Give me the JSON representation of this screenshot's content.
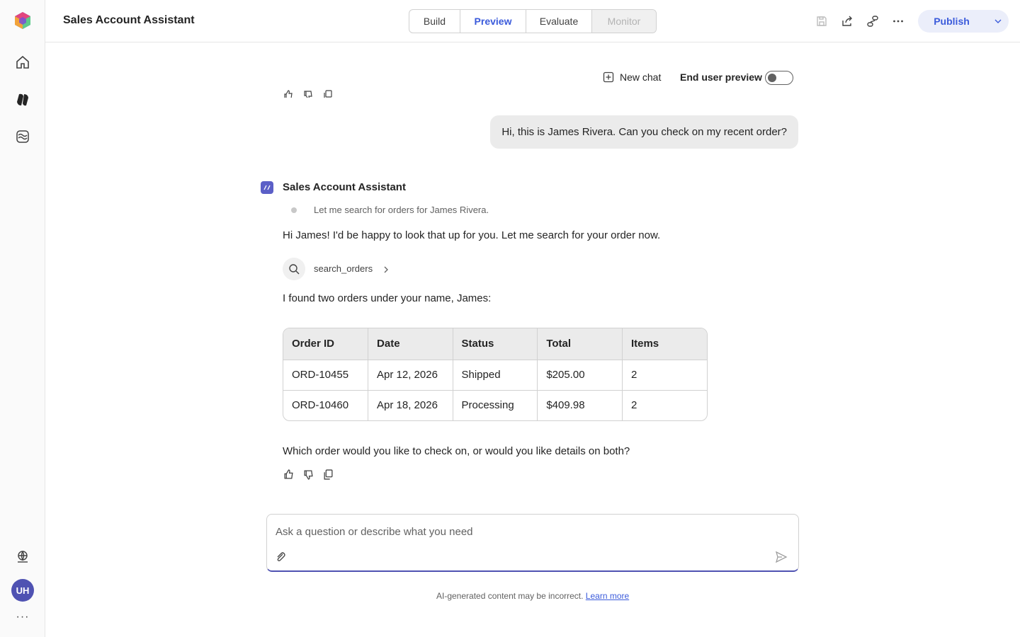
{
  "header": {
    "title": "Sales Account Assistant",
    "tabs": [
      {
        "label": "Build",
        "state": "normal"
      },
      {
        "label": "Preview",
        "state": "active"
      },
      {
        "label": "Evaluate",
        "state": "normal"
      },
      {
        "label": "Monitor",
        "state": "disabled"
      }
    ],
    "icons": [
      "save-icon",
      "share-icon",
      "link-icon",
      "more-icon"
    ],
    "publish_label": "Publish"
  },
  "rail": {
    "icons": [
      "app-logo-icon",
      "home-icon",
      "agents-icon",
      "knowledge-icon",
      "globe-icon"
    ],
    "avatar_initials": "UH",
    "more": "···"
  },
  "controls": {
    "new_chat": "New chat",
    "end_user_preview": "End user preview",
    "end_user_preview_on": false
  },
  "chat": {
    "user_message": "Hi, this is James Rivera. Can you check on my recent order?",
    "bot_name": "Sales Account Assistant",
    "thinking": "Let me search for orders for James Rivera.",
    "reply_intro": "Hi James! I'd be happy to look that up for you. Let me search for your order now.",
    "tool_call": "search_orders",
    "found_text": "I found two orders under your name, James:",
    "orders": {
      "headers": [
        "Order ID",
        "Date",
        "Status",
        "Total",
        "Items"
      ],
      "rows": [
        [
          "ORD-10455",
          "Apr 12, 2026",
          "Shipped",
          "$205.00",
          "2"
        ],
        [
          "ORD-10460",
          "Apr 18, 2026",
          "Processing",
          "$409.98",
          "2"
        ]
      ]
    },
    "question": "Which order would you like to check on, or would you like details on both?"
  },
  "composer": {
    "placeholder": "Ask a question or describe what you need"
  },
  "footer": {
    "disclaimer": "AI-generated content may be incorrect.",
    "learn_more": "Learn more"
  },
  "colors": {
    "accent": "#3b5bdb",
    "avatar": "#4f52b2",
    "bot_avatar": "#5b5fc7",
    "user_bubble": "#ebebeb"
  }
}
